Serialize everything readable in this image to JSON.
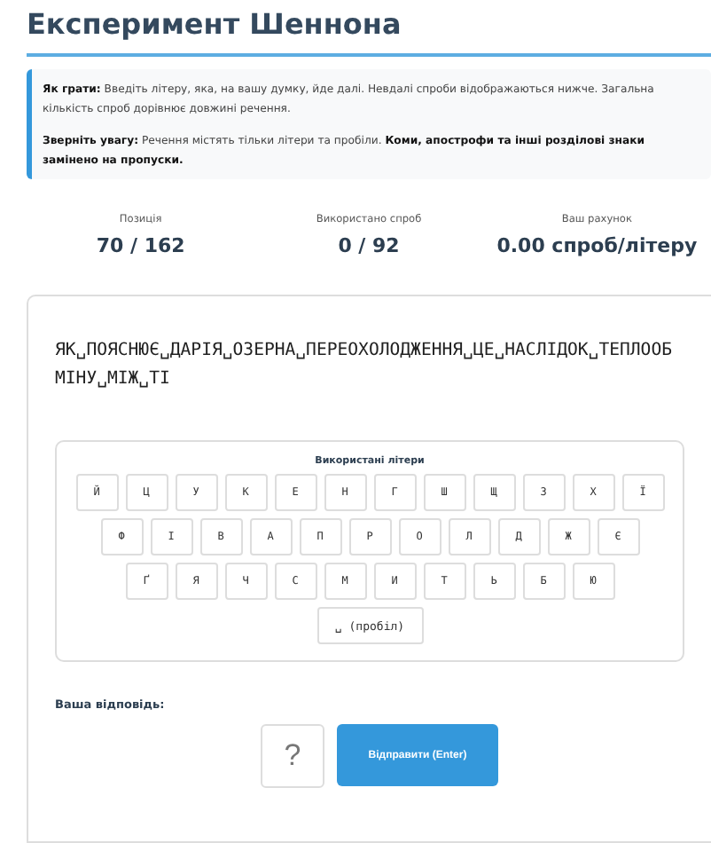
{
  "title": "Експеримент Шеннона",
  "info": [
    "**Як грати:** Введіть літеру, яка, на вашу думку, йде далі. Невдалі спроби відображаються нижче. Загальна кількість спроб дорівнює довжині речення.",
    "**Зверніть увагу:** Речення містять тільки літери та пробіли. **Коми, апострофи та інші розділові знаки замінено на пропуски.**"
  ],
  "stats": [
    {
      "label": "Позиція",
      "value": "70 / 162"
    },
    {
      "label": "Використано спроб",
      "value": "0 / 92"
    },
    {
      "label": "Ваш рахунок",
      "value": "0.00 спроб/літеру"
    }
  ],
  "sentence": "ЯК␣ПОЯСНЮЄ␣ДАРІЯ␣ОЗЕРНА␣ПЕРЕОХОЛОДЖЕННЯ␣ЦЕ␣НАСЛІДОК␣ТЕПЛООБМІНУ␣МІЖ␣ТІ",
  "keyboard": {
    "title": "Використані літери",
    "rows": [
      [
        "Й",
        "Ц",
        "У",
        "К",
        "Е",
        "Н",
        "Г",
        "Ш",
        "Щ",
        "З",
        "Х",
        "Ї"
      ],
      [
        "Ф",
        "І",
        "В",
        "А",
        "П",
        "Р",
        "О",
        "Л",
        "Д",
        "Ж",
        "Є"
      ],
      [
        "Ґ",
        "Я",
        "Ч",
        "С",
        "М",
        "И",
        "Т",
        "Ь",
        "Б",
        "Ю"
      ]
    ],
    "space": "␣ (пробіл)"
  },
  "answer": {
    "label": "Ваша відповідь:",
    "placeholder": "?",
    "button": "Відправити (Enter)"
  }
}
